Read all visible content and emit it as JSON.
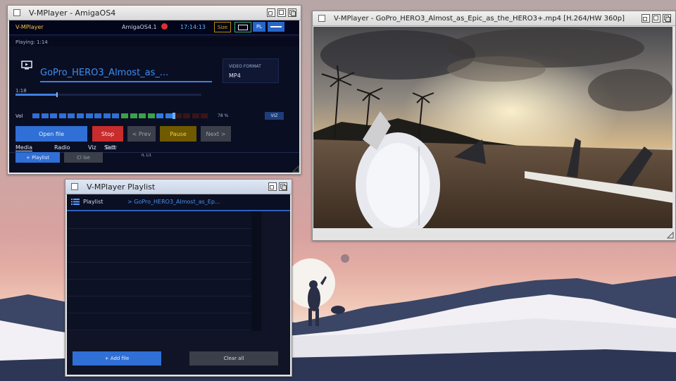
{
  "player_window": {
    "title": "V-MPlayer - AmigaOS4",
    "app_label": "V-MPlayer",
    "os_label": "AmigaOS4.1",
    "clock": "17:14:13",
    "size_btn": "Size",
    "pl_btn": "PL",
    "playing_status": "Playing: 1:14",
    "track_title": "GoPro_HERO3_Almost_as_...",
    "video_format_label": "VIDEO FORMAT",
    "video_format_value": "MP4",
    "position_time": "1:18",
    "position_fraction": 0.22,
    "vol_label": "Vol",
    "vol_percent": "78 %",
    "vol_level": 0.78,
    "viz_btn": "VIZ",
    "buttons": {
      "open": "Open file",
      "stop": "Stop",
      "prev": "< Prev",
      "pause": "Pause",
      "next": "Next >"
    },
    "tabs": [
      "Media",
      "Radio",
      "Viz",
      "Sett"
    ],
    "overlap_tab_text": "Eutr",
    "playlist_btn": "+ Playlist",
    "clear_btn": "Cl lse",
    "footer_small": "fL 1/1",
    "accent": "#2f6fd6",
    "stop_color": "#c92c2c",
    "pause_color": "#6f5a00"
  },
  "video_window": {
    "title": "V-MPlayer - GoPro_HERO3_Almost_as_Epic_as_the_HERO3+.mp4 [H.264/HW 360p]"
  },
  "playlist_window": {
    "title": "V-MPlayer Playlist",
    "header_label": "Playlist",
    "current_item": "> GoPro_HERO3_Almost_as_Ep...",
    "add_btn": "+ Add file",
    "clear_btn": "Clear all"
  }
}
